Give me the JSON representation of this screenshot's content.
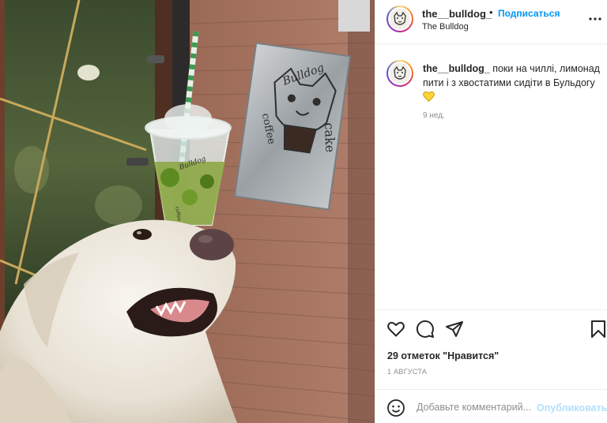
{
  "post": {
    "username": "the__bulldog_",
    "separator": "•",
    "follow_label": "Подписаться",
    "location": "The Bulldog",
    "more_icon": "more-horizontal-icon",
    "caption_text": " поки на чиллі, лимонад пити і з хвостатими сидіти в Бульдогу",
    "caption_emoji": "yellow-heart-icon",
    "caption_time": "9 нед.",
    "likes": "29 отметок \"Нравится\"",
    "date": "1 АВГУСТА"
  },
  "photo": {
    "sign_top_text": "Bulldog",
    "sign_left_text": "coffee",
    "sign_right_text": "cake",
    "cup_logo_text": "Bulldog",
    "cup_side_text": "coffee & cake"
  },
  "actions": {
    "like_icon": "heart-icon",
    "comment_icon": "comment-icon",
    "share_icon": "paper-plane-icon",
    "save_icon": "bookmark-icon"
  },
  "comment_box": {
    "emoji_icon": "emoji-icon",
    "placeholder": "Добавьте комментарий...",
    "publish_label": "Опубликовать"
  },
  "colors": {
    "link_blue": "#0095f6",
    "publish_disabled": "#b2dffc",
    "muted": "#8e8e8e"
  }
}
